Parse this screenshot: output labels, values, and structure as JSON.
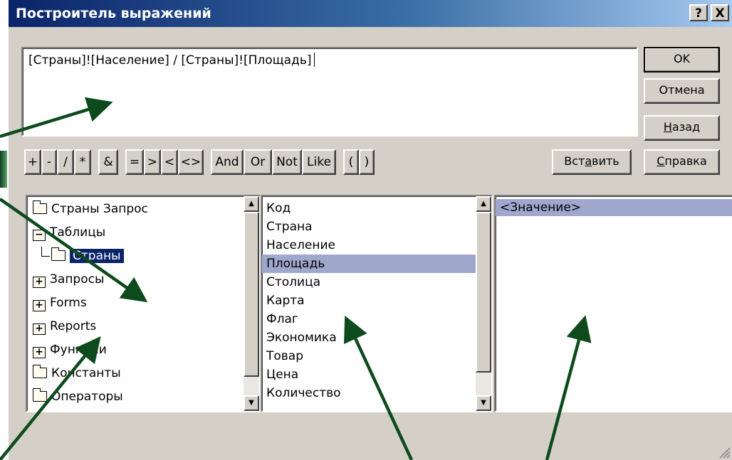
{
  "dialog": {
    "title": "Построитель выражений",
    "help_glyph": "?",
    "close_glyph": "X"
  },
  "expression": {
    "text": "[Страны]![Население] / [Страны]![Площадь]"
  },
  "buttons": {
    "ok": "OK",
    "cancel": "Отмена",
    "back_pre": "",
    "back_u": "Н",
    "back_post": "азад",
    "insert_pre": "Вст",
    "insert_u": "а",
    "insert_post": "вить",
    "help_pre": "",
    "help_u": "С",
    "help_post": "правка"
  },
  "operators": [
    "+",
    "-",
    "/",
    "*",
    "&",
    "=",
    ">",
    "<",
    "<>",
    "And",
    "Or",
    "Not",
    "Like",
    "(",
    ")"
  ],
  "tree": {
    "items": [
      {
        "label": "Страны Запрос",
        "icon": "folder-icon"
      },
      {
        "label": "Таблицы",
        "icon": "folder-open-icon"
      },
      {
        "label": "Страны",
        "icon": "folder-open-icon",
        "selected": true
      },
      {
        "label": "Запросы",
        "icon": "expand-icon"
      },
      {
        "label": "Forms",
        "icon": "expand-icon"
      },
      {
        "label": "Reports",
        "icon": "expand-icon"
      },
      {
        "label": "Функции",
        "icon": "expand-icon"
      },
      {
        "label": "Константы",
        "icon": "folder-icon"
      },
      {
        "label": "Операторы",
        "icon": "folder-icon"
      }
    ]
  },
  "fields": {
    "items": [
      "Код",
      "Страна",
      "Население",
      "Площадь",
      "Столица",
      "Карта",
      "Флаг",
      "Экономика",
      "Товар",
      "Цена",
      "Количество"
    ],
    "selected": "Площадь"
  },
  "values": {
    "items": [
      "<Значение>"
    ],
    "selected": "<Значение>"
  },
  "colors": {
    "title_gradient_start": "#0a246a",
    "selection_dark": "#0a246a",
    "selection_light": "#9fa8cc",
    "dialog_face": "#d4d0c8",
    "annotation_arrow": "#0d4a1c"
  }
}
